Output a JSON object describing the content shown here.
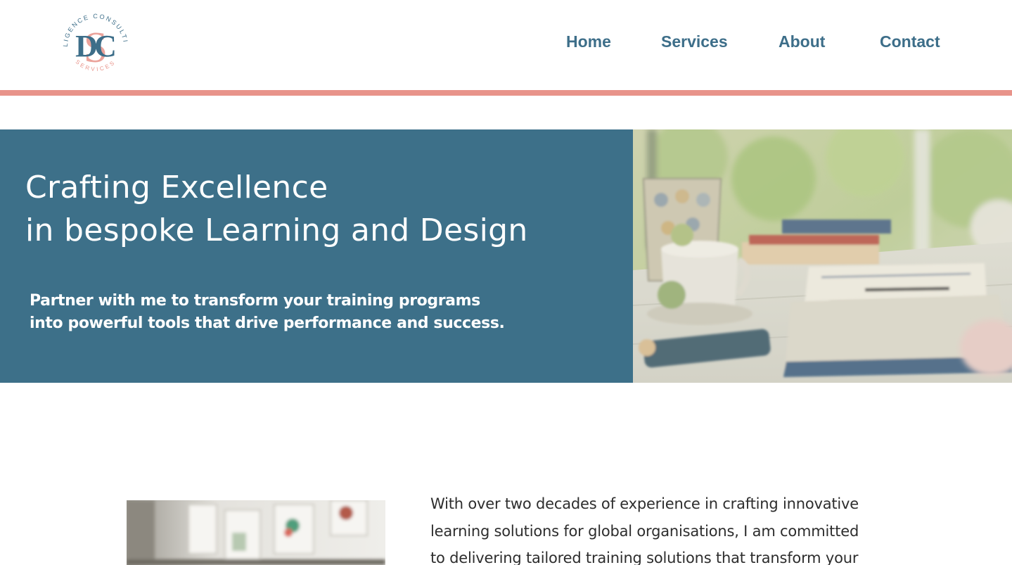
{
  "brand": {
    "ring_text_top": "DILIGENCE CONSULTING",
    "ring_text_bottom": "SERVICES",
    "monogram": "DSC",
    "colors": {
      "primary": "#3d6e89",
      "accent": "#e8938a"
    }
  },
  "nav": {
    "home": "Home",
    "services": "Services",
    "about": "About",
    "contact": "Contact"
  },
  "hero": {
    "title_line1": "Crafting Excellence",
    "title_line2": "in bespoke Learning and Design",
    "subtitle_line1": "Partner with me to transform your training programs",
    "subtitle_line2": "into powerful tools that drive performance and success.",
    "background": "#3d7089",
    "image_icon": "desk-workspace-photo"
  },
  "about": {
    "image_icon": "office-wall-photo",
    "text_line1": "With over two decades of experience in crafting innovative",
    "text_line2": "learning solutions for global organisations, I am committed",
    "text_line3": "to delivering tailored training solutions that transform your"
  }
}
